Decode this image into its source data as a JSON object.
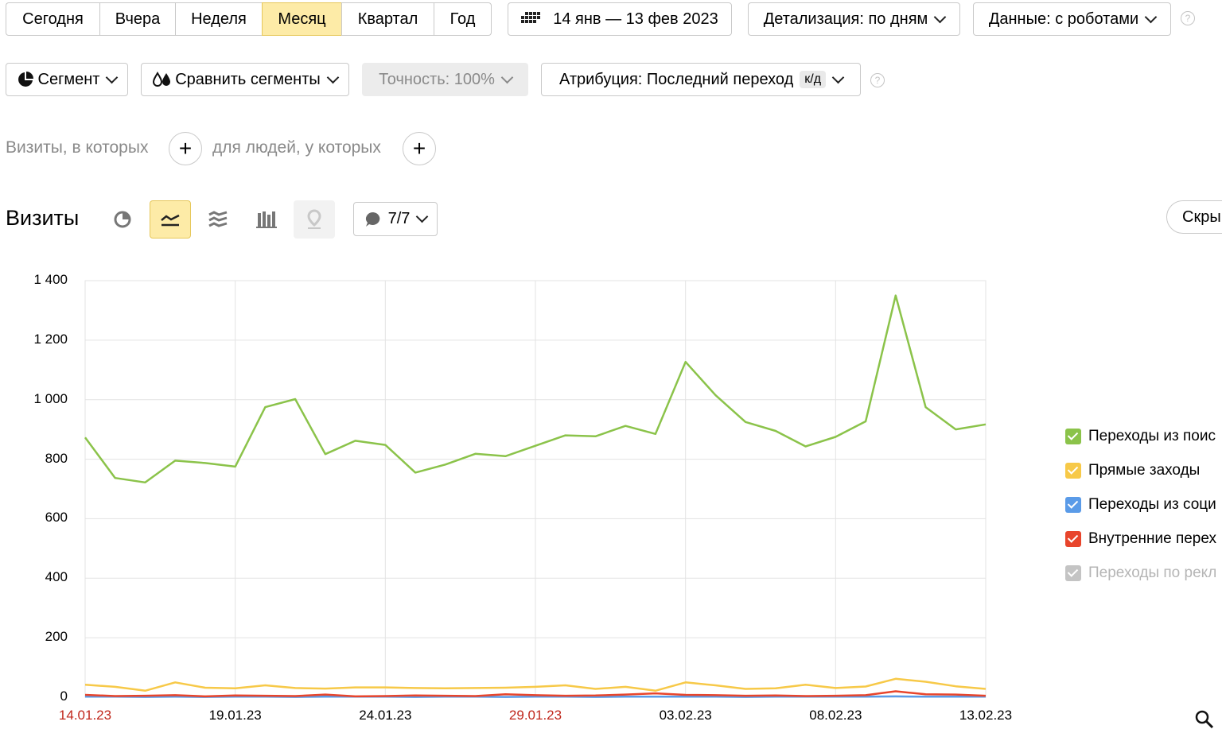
{
  "period_tabs": [
    "Сегодня",
    "Вчера",
    "Неделя",
    "Месяц",
    "Квартал",
    "Год"
  ],
  "active_period": "Месяц",
  "date_range": "14 янв — 13 фев 2023",
  "detail": "Детализация: по дням",
  "data_mode": "Данные: с роботами",
  "help_glyph": "?",
  "segment_label": "Сегмент",
  "compare_label": "Сравнить сегменты",
  "accuracy_label": "Точность: 100%",
  "attribution_label": "Атрибуция: Последний переход",
  "attribution_badge": "к/д",
  "visits_where": "Визиты, в которых",
  "people_where": "для людей, у которых",
  "section_title": "Визиты",
  "annotations_count": "7/7",
  "hide_button": "Скры",
  "colors": {
    "accent": "#fdeba7",
    "green": "#8bc34a",
    "yellow": "#f7c948",
    "blue": "#5a9be8",
    "red": "#e8452c",
    "grey": "#c4c4c4",
    "weekend": "#c0271c"
  },
  "chart_data": {
    "type": "line",
    "x": [
      "14.01.23",
      "15.01.23",
      "16.01.23",
      "17.01.23",
      "18.01.23",
      "19.01.23",
      "20.01.23",
      "21.01.23",
      "22.01.23",
      "23.01.23",
      "24.01.23",
      "25.01.23",
      "26.01.23",
      "27.01.23",
      "28.01.23",
      "29.01.23",
      "30.01.23",
      "31.01.23",
      "01.02.23",
      "02.02.23",
      "03.02.23",
      "04.02.23",
      "05.02.23",
      "06.02.23",
      "07.02.23",
      "08.02.23",
      "09.02.23",
      "10.02.23",
      "11.02.23",
      "12.02.23",
      "13.02.23"
    ],
    "tick_labels": [
      "14.01.23",
      "19.01.23",
      "24.01.23",
      "29.01.23",
      "03.02.23",
      "08.02.23",
      "13.02.23"
    ],
    "red_ticks": [
      "14.01.23",
      "29.01.23"
    ],
    "yticks": [
      "1 400",
      "1 200",
      "1 000",
      "800",
      "600",
      "400",
      "200",
      "0"
    ],
    "ylim": [
      0,
      1400
    ],
    "series": [
      {
        "name": "Переходы из поис",
        "color": "#8bc34a",
        "values": [
          873,
          737,
          722,
          795,
          787,
          775,
          975,
          1002,
          817,
          862,
          848,
          755,
          782,
          818,
          810,
          845,
          880,
          877,
          912,
          885,
          1127,
          1015,
          925,
          895,
          843,
          875,
          927,
          1350,
          975,
          900,
          917
        ]
      },
      {
        "name": "Прямые заходы",
        "color": "#f7c948",
        "values": [
          42,
          35,
          22,
          50,
          32,
          30,
          40,
          31,
          29,
          33,
          33,
          31,
          30,
          31,
          32,
          35,
          40,
          28,
          35,
          22,
          50,
          40,
          28,
          30,
          42,
          31,
          36,
          62,
          52,
          37,
          28
        ]
      },
      {
        "name": "Переходы из соци",
        "color": "#5a9be8",
        "values": [
          2,
          2,
          1,
          2,
          1,
          2,
          2,
          1,
          2,
          2,
          2,
          1,
          2,
          2,
          1,
          2,
          2,
          1,
          2,
          2,
          2,
          2,
          1,
          2,
          2,
          2,
          2,
          3,
          2,
          2,
          2
        ]
      },
      {
        "name": "Внутренние перех",
        "color": "#e8452c",
        "values": [
          8,
          4,
          5,
          7,
          3,
          6,
          5,
          4,
          9,
          3,
          4,
          6,
          5,
          4,
          10,
          7,
          5,
          6,
          9,
          13,
          8,
          7,
          5,
          6,
          4,
          5,
          7,
          20,
          10,
          9,
          5
        ]
      },
      {
        "name": "Переходы по рекл",
        "color": "#c4c4c4",
        "disabled": true,
        "values": [
          0,
          0,
          0,
          0,
          0,
          0,
          0,
          0,
          0,
          0,
          0,
          0,
          0,
          0,
          0,
          0,
          0,
          0,
          0,
          0,
          0,
          0,
          0,
          0,
          0,
          0,
          0,
          0,
          0,
          0,
          0
        ]
      }
    ],
    "grid": true,
    "legend_position": "right"
  }
}
